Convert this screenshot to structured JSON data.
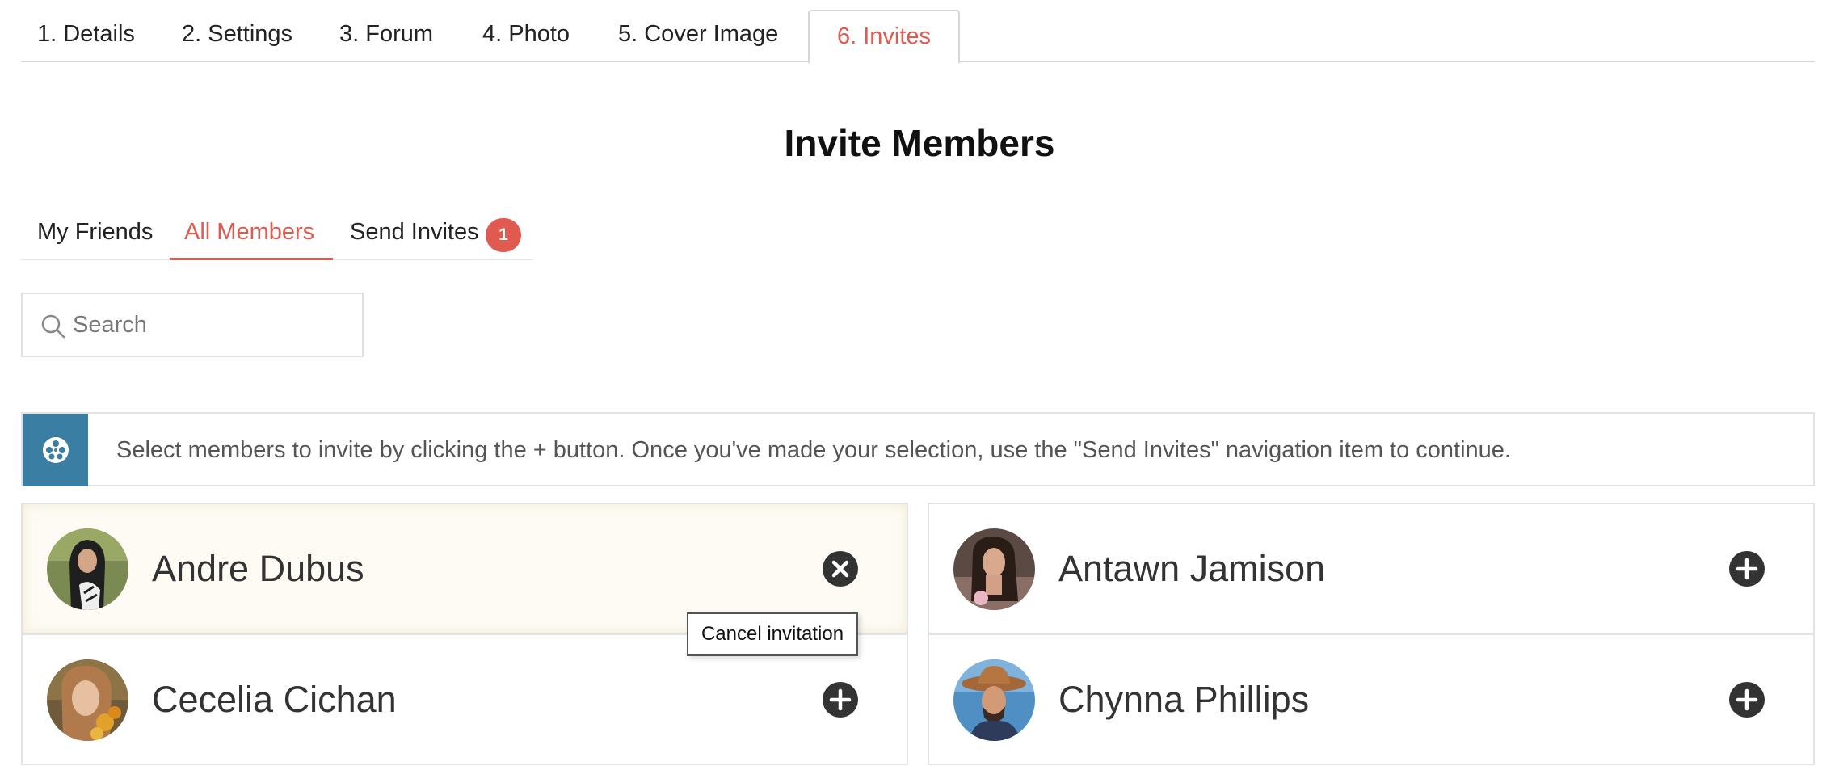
{
  "step_tabs": [
    {
      "label": "1. Details"
    },
    {
      "label": "2. Settings"
    },
    {
      "label": "3. Forum"
    },
    {
      "label": "4. Photo"
    },
    {
      "label": "5. Cover Image"
    },
    {
      "label": "6. Invites",
      "active": true
    }
  ],
  "page_title": "Invite Members",
  "sub_nav": {
    "items": [
      {
        "label": "My Friends"
      },
      {
        "label": "All Members",
        "active": true
      },
      {
        "label": "Send Invites",
        "badge": "1"
      }
    ]
  },
  "search": {
    "placeholder": "Search",
    "value": ""
  },
  "info": {
    "icon": "info-icon",
    "text": "Select members to invite by clicking the + button. Once you've made your selection, use the \"Send Invites\" navigation item to continue."
  },
  "members": [
    {
      "name": "Andre Dubus",
      "selected": true,
      "action": "cancel"
    },
    {
      "name": "Antawn Jamison",
      "selected": false,
      "action": "add"
    },
    {
      "name": "Cecelia Cichan",
      "selected": false,
      "action": "add"
    },
    {
      "name": "Chynna Phillips",
      "selected": false,
      "action": "add"
    }
  ],
  "tooltip": {
    "text": "Cancel invitation"
  },
  "colors": {
    "accent": "#e05a4f",
    "info_icon_bg": "#3a7fa3",
    "selected_card_bg": "#fdfbf4",
    "action_button": "#333333"
  }
}
